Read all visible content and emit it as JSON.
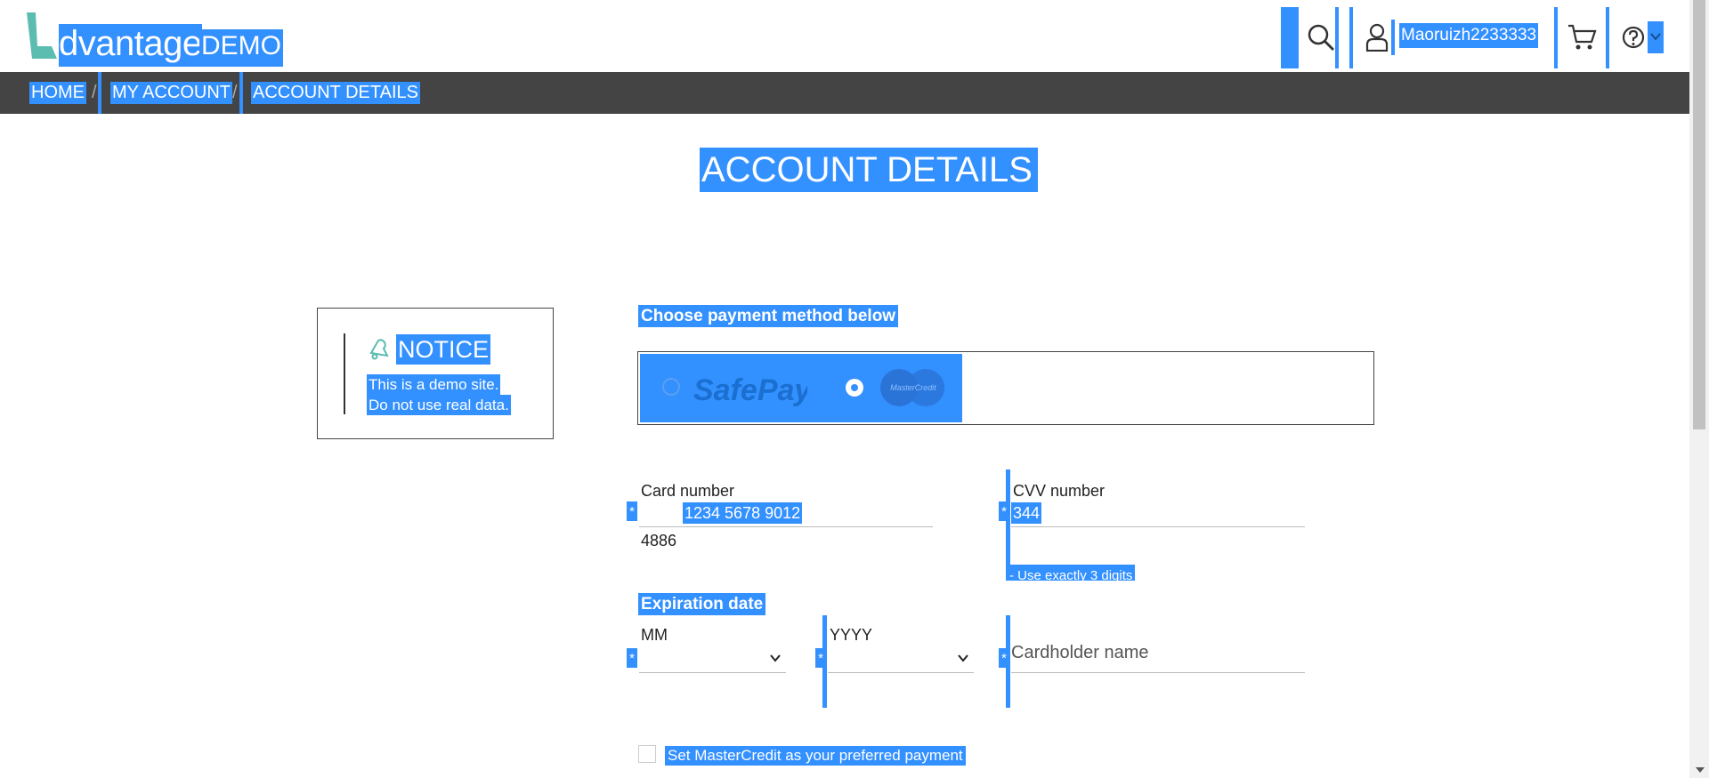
{
  "brand": {
    "logo_word": "dvantage",
    "logo_demo": "DEMO"
  },
  "header": {
    "user_name": "Maoruizh2233333",
    "icons": [
      "search-icon",
      "user-icon",
      "cart-icon",
      "help-icon",
      "chevron-down-icon"
    ]
  },
  "breadcrumb": {
    "items": [
      "HOME",
      "MY ACCOUNT",
      "ACCOUNT DETAILS"
    ],
    "separator": "/"
  },
  "page": {
    "title": "ACCOUNT DETAILS"
  },
  "notice": {
    "title": "NOTICE",
    "line1": "This is a demo site.",
    "line2": "Do not use real data."
  },
  "payment": {
    "label": "Choose payment method below",
    "options": [
      "SafePay",
      "MasterCredit"
    ],
    "selected": "MasterCredit"
  },
  "form": {
    "card_number_label": "Card number",
    "card_number_value": "1234 5678 9012",
    "card_number_overflow": "4886",
    "cvv_label": "CVV number",
    "cvv_value": "344",
    "cvv_hint": "- Use exactly 3 digits",
    "expiration_label": "Expiration date",
    "mm_label": "MM",
    "yyyy_label": "YYYY",
    "cardholder_placeholder": "Cardholder name",
    "required_mark": "*",
    "preferred_label": "Set MasterCredit as your preferred payment"
  },
  "colors": {
    "selection": "#3390ff",
    "breadcrumb_bg": "#444444",
    "logo_teal": "#5bbcb0",
    "safepay_blue": "#1a6fd0"
  }
}
